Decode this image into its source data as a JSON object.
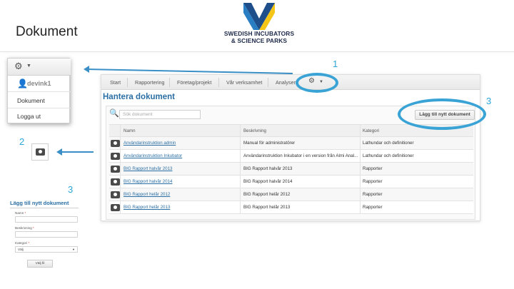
{
  "slide": {
    "title": "Dokument",
    "logo_line1": "SWEDISH INCUBATORS",
    "logo_line2": "& SCIENCE PARKS"
  },
  "callouts": [
    "1",
    "2",
    "3",
    "3"
  ],
  "gear_menu": {
    "gear_icon": "⚙",
    "caret": "▼",
    "user_icon": "👤",
    "username": "devink1",
    "items": [
      "Dokument",
      "Logga ut"
    ]
  },
  "app": {
    "nav": {
      "tabs": [
        "Start",
        "Rapportering",
        "Företag/projekt",
        "Vår verksamhet",
        "Analysera"
      ],
      "gear_icon": "⚙",
      "caret": "▼"
    },
    "heading": "Hantera dokument",
    "search": {
      "icon": "🔍",
      "placeholder": "Sök dokument"
    },
    "add_button": "Lägg till nytt dokument",
    "table": {
      "columns": [
        "Namn",
        "Beskrivning",
        "Kategori"
      ],
      "rows": [
        {
          "name": "Användarinstruktion admin",
          "description": "Manual för administratörer",
          "category": "Lathundar och definitioner"
        },
        {
          "name": "Användarinstruktion Inkubator",
          "description": "Användarinstruktion Inkubator i en version från Almi Anal...",
          "category": "Lathundar och definitioner"
        },
        {
          "name": "BIG Rapport halvår 2013",
          "description": "BIG Rapport halvår 2013",
          "category": "Rapporter"
        },
        {
          "name": "BIG Rapport halvår 2014",
          "description": "BIG Rapport halvår 2014",
          "category": "Rapporter"
        },
        {
          "name": "BIG Rapport helår 2012",
          "description": "BIG Rapport helår 2012",
          "category": "Rapporter"
        },
        {
          "name": "BIG Rapport helår 2013",
          "description": "BIG Rapport helår 2013",
          "category": "Rapporter"
        }
      ]
    }
  },
  "form": {
    "title": "Lägg till nytt dokument",
    "name_label": "Namn",
    "description_label": "Beskrivning",
    "category_label": "Kategori",
    "required_mark": "*",
    "category_value": "Välj",
    "submit": "Välj fil"
  },
  "colors": {
    "accent": "#2b6fa5",
    "callout": "#2aa6d8",
    "ellipse": "#3aa3d6",
    "logo_blue": "#2a7fc4",
    "logo_yellow": "#f5c518",
    "logo_navy": "#1e2a4a"
  }
}
